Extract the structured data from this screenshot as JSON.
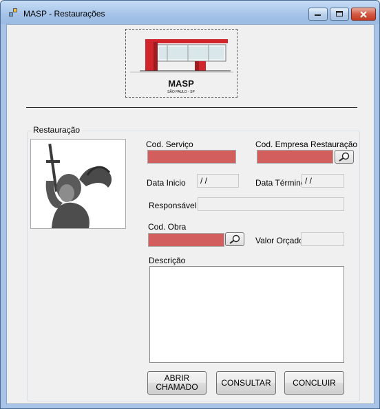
{
  "window": {
    "title": "MASP - Restaurações"
  },
  "logo": {
    "name": "MASP",
    "subtitle": "SÃO PAULO - SP"
  },
  "group": {
    "label": "Restauração"
  },
  "form": {
    "cod_servico_label": "Cod. Serviço",
    "cod_servico_value": "",
    "cod_empresa_label": "Cod. Empresa Restauração",
    "cod_empresa_value": "",
    "data_inicio_label": "Data Inicio",
    "data_inicio_value": " /  /",
    "data_termino_label": "Data Término",
    "data_termino_value": " /  /",
    "responsavel_label": "Responsável",
    "responsavel_value": "",
    "cod_obra_label": "Cod. Obra",
    "cod_obra_value": "",
    "valor_orcado_label": "Valor Orçado",
    "valor_orcado_value": "",
    "descricao_label": "Descrição",
    "descricao_value": ""
  },
  "buttons": {
    "abrir_line1": "ABRIR",
    "abrir_line2": "CHAMADO",
    "consultar": "CONSULTAR",
    "concluir": "CONCLUIR"
  },
  "colors": {
    "required_field": "#d35e5e",
    "logo_red": "#d0262b"
  },
  "icons": {
    "search": "magnifier-icon",
    "minimize": "minimize-icon",
    "maximize": "maximize-icon",
    "close": "close-icon"
  }
}
